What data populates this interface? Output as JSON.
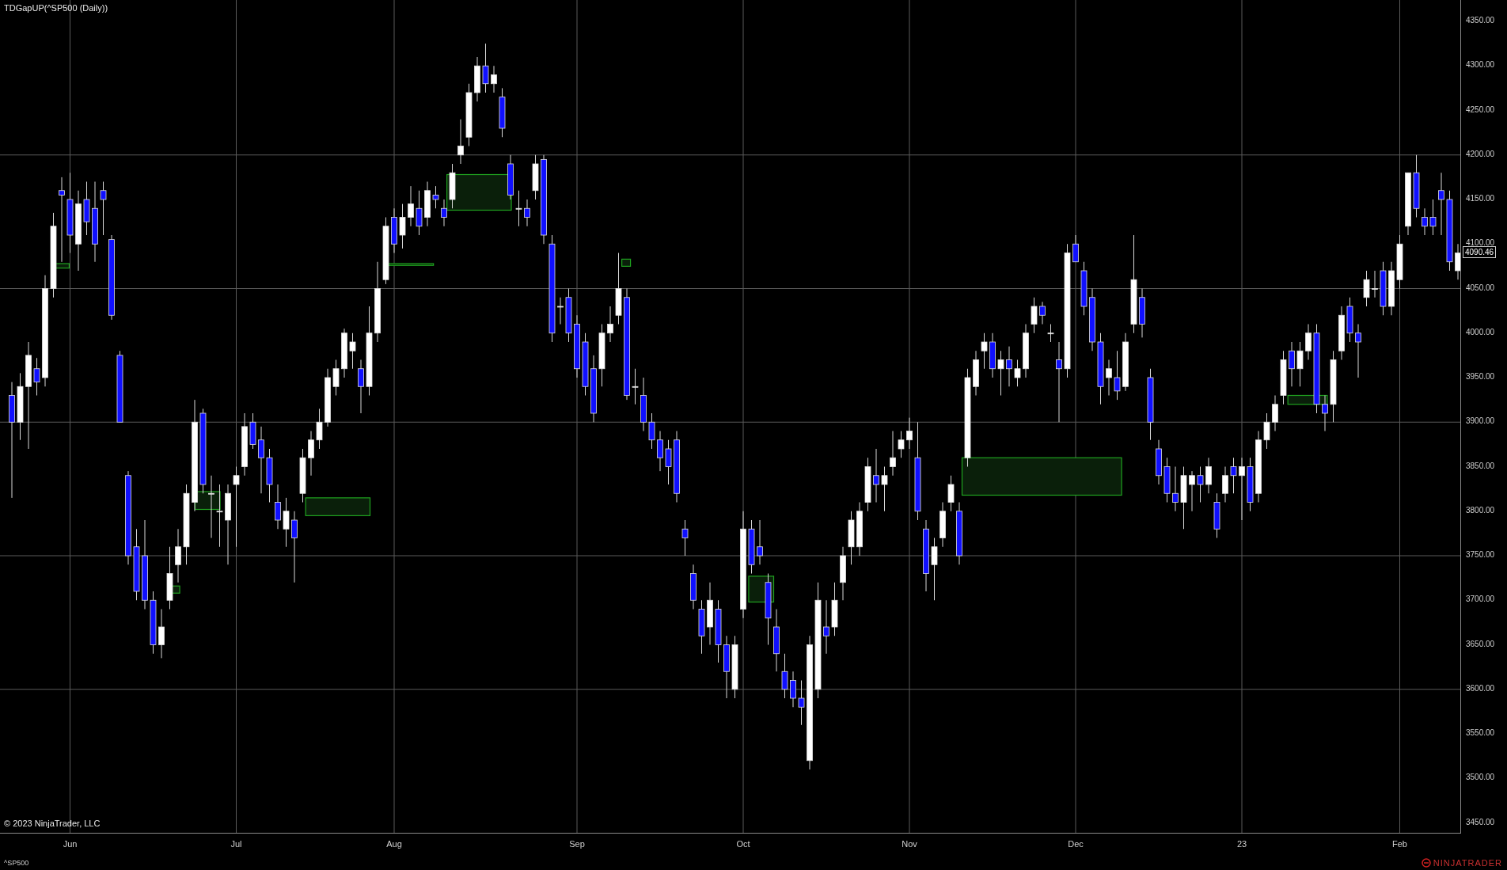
{
  "chart": {
    "title": "TDGapUP(^SP500 (Daily))",
    "copyright": "© 2023 NinjaTrader, LLC",
    "last_price": "4090.46",
    "chart_data": {
      "type": "candlestick",
      "ylim": [
        3438,
        4374
      ],
      "grid": true,
      "categories": [
        null,
        null,
        null,
        null,
        null,
        null,
        null,
        "Jun",
        null,
        null,
        null,
        null,
        null,
        null,
        null,
        null,
        null,
        null,
        null,
        null,
        null,
        null,
        null,
        null,
        null,
        null,
        null,
        "Jul",
        null,
        null,
        null,
        null,
        null,
        null,
        null,
        null,
        null,
        null,
        null,
        null,
        null,
        null,
        null,
        null,
        null,
        null,
        "Aug",
        null,
        null,
        null,
        null,
        null,
        null,
        null,
        null,
        null,
        null,
        null,
        null,
        null,
        null,
        null,
        null,
        null,
        null,
        null,
        null,
        null,
        "Sep",
        null,
        null,
        null,
        null,
        null,
        null,
        null,
        null,
        null,
        null,
        null,
        null,
        null,
        null,
        null,
        null,
        null,
        null,
        null,
        "Oct",
        null,
        null,
        null,
        null,
        null,
        null,
        null,
        null,
        null,
        null,
        null,
        null,
        null,
        null,
        null,
        null,
        null,
        null,
        null,
        "Nov",
        null,
        null,
        null,
        null,
        null,
        null,
        null,
        null,
        null,
        null,
        null,
        null,
        null,
        null,
        null,
        null,
        null,
        null,
        null,
        "Dec",
        null,
        null,
        null,
        null,
        null,
        null,
        null,
        null,
        null,
        null,
        null,
        null,
        null,
        null,
        null,
        null,
        null,
        null,
        null,
        "23",
        null,
        null,
        null,
        null,
        null,
        null,
        null,
        null,
        null,
        null,
        null,
        null,
        null,
        null,
        null,
        null,
        null,
        null,
        "Feb",
        null,
        null,
        null,
        null,
        null,
        null,
        null
      ],
      "yticks": [
        {
          "value": 4350,
          "label": "4350.00"
        },
        {
          "value": 4300,
          "label": "4300.00"
        },
        {
          "value": 4250,
          "label": "4250.00"
        },
        {
          "value": 4200,
          "label": "4200.00"
        },
        {
          "value": 4150,
          "label": "4150.00"
        },
        {
          "value": 4100,
          "label": "4100.00"
        },
        {
          "value": 4050,
          "label": "4050.00"
        },
        {
          "value": 4000,
          "label": "4000.00"
        },
        {
          "value": 3950,
          "label": "3950.00"
        },
        {
          "value": 3900,
          "label": "3900.00"
        },
        {
          "value": 3850,
          "label": "3850.00"
        },
        {
          "value": 3800,
          "label": "3800.00"
        },
        {
          "value": 3750,
          "label": "3750.00"
        },
        {
          "value": 3700,
          "label": "3700.00"
        },
        {
          "value": 3650,
          "label": "3650.00"
        },
        {
          "value": 3600,
          "label": "3600.00"
        },
        {
          "value": 3550,
          "label": "3550.00"
        },
        {
          "value": 3500,
          "label": "3500.00"
        },
        {
          "value": 3450,
          "label": "3450.00"
        }
      ],
      "ohlc": [
        [
          3930,
          3945,
          3815,
          3900
        ],
        [
          3900,
          3955,
          3880,
          3940
        ],
        [
          3940,
          3990,
          3870,
          3975
        ],
        [
          3960,
          3972,
          3930,
          3945
        ],
        [
          3950,
          4065,
          3940,
          4050
        ],
        [
          4050,
          4135,
          4040,
          4120
        ],
        [
          4160,
          4175,
          4080,
          4155
        ],
        [
          4150,
          4180,
          4090,
          4110
        ],
        [
          4100,
          4160,
          4070,
          4145
        ],
        [
          4150,
          4170,
          4110,
          4125
        ],
        [
          4140,
          4170,
          4080,
          4100
        ],
        [
          4160,
          4170,
          4110,
          4150
        ],
        [
          4105,
          4110,
          4015,
          4020
        ],
        [
          3975,
          3980,
          3900,
          3900
        ],
        [
          3840,
          3845,
          3740,
          3750
        ],
        [
          3760,
          3780,
          3700,
          3710
        ],
        [
          3750,
          3790,
          3690,
          3700
        ],
        [
          3700,
          3710,
          3640,
          3650
        ],
        [
          3650,
          3690,
          3635,
          3670
        ],
        [
          3700,
          3760,
          3690,
          3730
        ],
        [
          3740,
          3780,
          3720,
          3760
        ],
        [
          3760,
          3830,
          3740,
          3820
        ],
        [
          3810,
          3925,
          3800,
          3900
        ],
        [
          3910,
          3915,
          3820,
          3830
        ],
        [
          3820,
          3840,
          3770,
          3820
        ],
        [
          3800,
          3830,
          3760,
          3800
        ],
        [
          3790,
          3830,
          3740,
          3820
        ],
        [
          3830,
          3850,
          3760,
          3840
        ],
        [
          3850,
          3910,
          3840,
          3895
        ],
        [
          3900,
          3910,
          3870,
          3875
        ],
        [
          3880,
          3895,
          3820,
          3860
        ],
        [
          3860,
          3870,
          3810,
          3830
        ],
        [
          3810,
          3830,
          3780,
          3790
        ],
        [
          3780,
          3815,
          3760,
          3800
        ],
        [
          3790,
          3800,
          3720,
          3770
        ],
        [
          3820,
          3870,
          3810,
          3860
        ],
        [
          3860,
          3890,
          3840,
          3880
        ],
        [
          3880,
          3915,
          3870,
          3900
        ],
        [
          3900,
          3960,
          3895,
          3950
        ],
        [
          3940,
          3970,
          3930,
          3960
        ],
        [
          3960,
          4005,
          3950,
          4000
        ],
        [
          3980,
          4000,
          3960,
          3990
        ],
        [
          3960,
          3970,
          3910,
          3940
        ],
        [
          3940,
          4030,
          3930,
          4000
        ],
        [
          4000,
          4080,
          3990,
          4050
        ],
        [
          4060,
          4130,
          4055,
          4120
        ],
        [
          4130,
          4140,
          4090,
          4100
        ],
        [
          4110,
          4145,
          4095,
          4130
        ],
        [
          4130,
          4165,
          4120,
          4145
        ],
        [
          4140,
          4160,
          4110,
          4120
        ],
        [
          4130,
          4170,
          4120,
          4160
        ],
        [
          4155,
          4165,
          4140,
          4150
        ],
        [
          4140,
          4150,
          4120,
          4130
        ],
        [
          4150,
          4190,
          4140,
          4180
        ],
        [
          4200,
          4240,
          4190,
          4210
        ],
        [
          4220,
          4280,
          4210,
          4270
        ],
        [
          4270,
          4310,
          4260,
          4300
        ],
        [
          4300,
          4325,
          4270,
          4280
        ],
        [
          4280,
          4300,
          4270,
          4290
        ],
        [
          4265,
          4275,
          4220,
          4230
        ],
        [
          4190,
          4200,
          4150,
          4155
        ],
        [
          4140,
          4160,
          4120,
          4140
        ],
        [
          4140,
          4150,
          4120,
          4130
        ],
        [
          4160,
          4200,
          4150,
          4190
        ],
        [
          4195,
          4200,
          4100,
          4110
        ],
        [
          4100,
          4110,
          3990,
          4000
        ],
        [
          4030,
          4040,
          4010,
          4030
        ],
        [
          4040,
          4050,
          3990,
          4000
        ],
        [
          4010,
          4020,
          3950,
          3960
        ],
        [
          3990,
          4000,
          3930,
          3940
        ],
        [
          3960,
          3975,
          3900,
          3910
        ],
        [
          3960,
          4010,
          3940,
          4000
        ],
        [
          4000,
          4030,
          3990,
          4010
        ],
        [
          4020,
          4090,
          4010,
          4050
        ],
        [
          4040,
          4050,
          3925,
          3930
        ],
        [
          3940,
          3960,
          3920,
          3940
        ],
        [
          3930,
          3950,
          3890,
          3900
        ],
        [
          3900,
          3910,
          3870,
          3880
        ],
        [
          3880,
          3890,
          3845,
          3860
        ],
        [
          3870,
          3880,
          3830,
          3850
        ],
        [
          3880,
          3890,
          3810,
          3820
        ],
        [
          3780,
          3790,
          3750,
          3770
        ],
        [
          3730,
          3740,
          3690,
          3700
        ],
        [
          3690,
          3700,
          3640,
          3660
        ],
        [
          3670,
          3720,
          3650,
          3700
        ],
        [
          3690,
          3700,
          3630,
          3650
        ],
        [
          3650,
          3660,
          3590,
          3620
        ],
        [
          3600,
          3660,
          3590,
          3650
        ],
        [
          3690,
          3800,
          3680,
          3780
        ],
        [
          3780,
          3790,
          3730,
          3740
        ],
        [
          3760,
          3790,
          3740,
          3750
        ],
        [
          3720,
          3730,
          3650,
          3680
        ],
        [
          3670,
          3690,
          3620,
          3640
        ],
        [
          3620,
          3640,
          3590,
          3600
        ],
        [
          3610,
          3620,
          3580,
          3590
        ],
        [
          3590,
          3610,
          3560,
          3580
        ],
        [
          3520,
          3660,
          3510,
          3650
        ],
        [
          3600,
          3720,
          3590,
          3700
        ],
        [
          3670,
          3700,
          3640,
          3660
        ],
        [
          3670,
          3720,
          3660,
          3700
        ],
        [
          3720,
          3760,
          3700,
          3750
        ],
        [
          3760,
          3800,
          3740,
          3790
        ],
        [
          3760,
          3810,
          3750,
          3800
        ],
        [
          3810,
          3860,
          3800,
          3850
        ],
        [
          3840,
          3870,
          3810,
          3830
        ],
        [
          3830,
          3850,
          3800,
          3840
        ],
        [
          3850,
          3890,
          3840,
          3860
        ],
        [
          3870,
          3890,
          3860,
          3880
        ],
        [
          3880,
          3905,
          3870,
          3890
        ],
        [
          3860,
          3900,
          3790,
          3800
        ],
        [
          3780,
          3790,
          3710,
          3730
        ],
        [
          3740,
          3770,
          3700,
          3760
        ],
        [
          3770,
          3810,
          3760,
          3800
        ],
        [
          3810,
          3840,
          3800,
          3830
        ],
        [
          3800,
          3810,
          3740,
          3750
        ],
        [
          3860,
          3960,
          3850,
          3950
        ],
        [
          3940,
          3980,
          3930,
          3970
        ],
        [
          3980,
          4000,
          3960,
          3990
        ],
        [
          3990,
          4000,
          3950,
          3960
        ],
        [
          3960,
          3980,
          3930,
          3970
        ],
        [
          3970,
          3985,
          3940,
          3960
        ],
        [
          3950,
          3970,
          3940,
          3960
        ],
        [
          3960,
          4010,
          3950,
          4000
        ],
        [
          4010,
          4040,
          4000,
          4030
        ],
        [
          4030,
          4035,
          4010,
          4020
        ],
        [
          4000,
          4010,
          3990,
          4000
        ],
        [
          3970,
          3990,
          3900,
          3960
        ],
        [
          3960,
          4100,
          3950,
          4090
        ],
        [
          4100,
          4110,
          4080,
          4080
        ],
        [
          4070,
          4080,
          4020,
          4030
        ],
        [
          4040,
          4050,
          3980,
          3990
        ],
        [
          3990,
          4000,
          3920,
          3940
        ],
        [
          3950,
          3970,
          3930,
          3960
        ],
        [
          3950,
          3980,
          3925,
          3935
        ],
        [
          3940,
          4000,
          3935,
          3990
        ],
        [
          4010,
          4110,
          4000,
          4060
        ],
        [
          4040,
          4050,
          3995,
          4010
        ],
        [
          3950,
          3960,
          3880,
          3900
        ],
        [
          3870,
          3880,
          3830,
          3840
        ],
        [
          3850,
          3860,
          3810,
          3820
        ],
        [
          3820,
          3850,
          3800,
          3810
        ],
        [
          3810,
          3850,
          3780,
          3840
        ],
        [
          3830,
          3845,
          3800,
          3840
        ],
        [
          3840,
          3850,
          3810,
          3830
        ],
        [
          3830,
          3860,
          3820,
          3850
        ],
        [
          3810,
          3820,
          3770,
          3780
        ],
        [
          3820,
          3850,
          3810,
          3840
        ],
        [
          3850,
          3860,
          3820,
          3840
        ],
        [
          3840,
          3860,
          3790,
          3850
        ],
        [
          3850,
          3860,
          3800,
          3810
        ],
        [
          3820,
          3890,
          3810,
          3880
        ],
        [
          3880,
          3910,
          3870,
          3900
        ],
        [
          3900,
          3930,
          3890,
          3920
        ],
        [
          3930,
          3980,
          3920,
          3970
        ],
        [
          3980,
          3990,
          3940,
          3960
        ],
        [
          3960,
          3990,
          3940,
          3980
        ],
        [
          3980,
          4010,
          3970,
          4000
        ],
        [
          4000,
          4010,
          3910,
          3920
        ],
        [
          3920,
          3930,
          3890,
          3910
        ],
        [
          3920,
          3980,
          3900,
          3970
        ],
        [
          3980,
          4030,
          3970,
          4020
        ],
        [
          4030,
          4040,
          3990,
          4000
        ],
        [
          4000,
          4010,
          3950,
          3990
        ],
        [
          4040,
          4070,
          4030,
          4060
        ],
        [
          4050,
          4070,
          4040,
          4050
        ],
        [
          4070,
          4080,
          4020,
          4030
        ],
        [
          4030,
          4080,
          4020,
          4070
        ],
        [
          4060,
          4110,
          4050,
          4100
        ],
        [
          4120,
          4180,
          4110,
          4180
        ],
        [
          4180,
          4200,
          4130,
          4140
        ],
        [
          4130,
          4140,
          4110,
          4120
        ],
        [
          4130,
          4150,
          4110,
          4120
        ],
        [
          4160,
          4180,
          4110,
          4150
        ],
        [
          4150,
          4160,
          4070,
          4080
        ],
        [
          4070,
          4100,
          4060,
          4090
        ]
      ]
    }
  },
  "status_bar": {
    "instrument": "^SP500",
    "logo": "NINJATRADER"
  }
}
